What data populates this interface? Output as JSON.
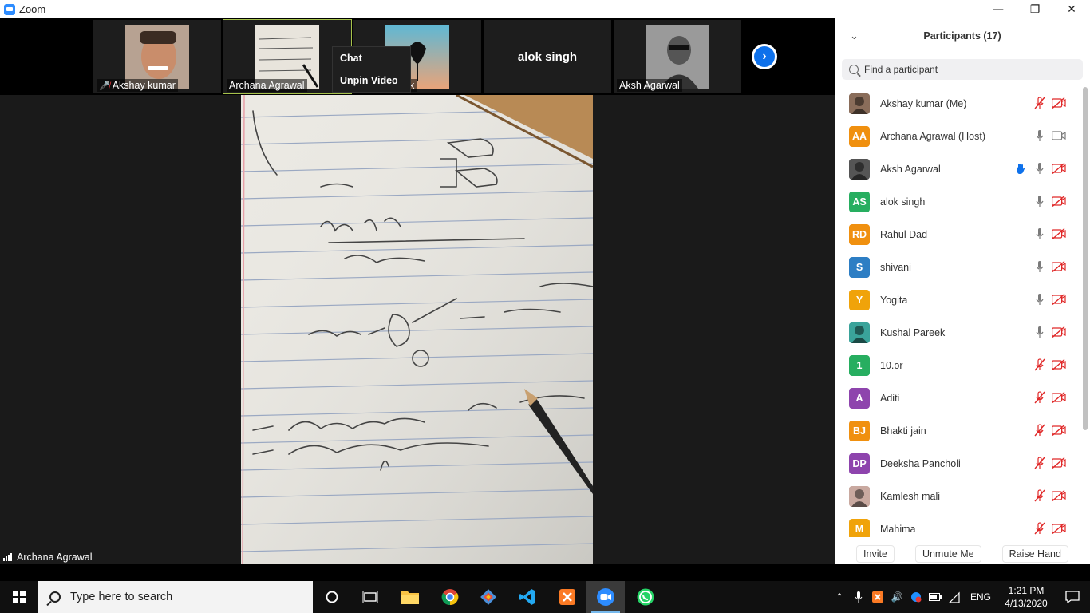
{
  "window": {
    "title": "Zoom",
    "minimize": "—",
    "maximize": "❐",
    "close": "✕"
  },
  "thumbnails": [
    {
      "label": "Akshay kumar",
      "muted": true
    },
    {
      "label": "Archana Agrawal",
      "muted": false,
      "active": true
    },
    {
      "label": "ek",
      "muted": false
    },
    {
      "bigname": "alok singh"
    },
    {
      "label": "Aksh Agarwal",
      "muted": false
    }
  ],
  "context_menu": {
    "items": [
      "Chat",
      "Unpin Video"
    ]
  },
  "main_video": {
    "speaker_label": "Archana Agrawal"
  },
  "participants_panel": {
    "title": "Participants (17)",
    "search_placeholder": "Find a participant",
    "participants": [
      {
        "name": "Akshay kumar (Me)",
        "avatar": "photo",
        "color": "#8a6d5a",
        "mic": "muted",
        "video": "off"
      },
      {
        "name": "Archana Agrawal (Host)",
        "initials": "AA",
        "color": "#f0900f",
        "mic": "on",
        "video": "on"
      },
      {
        "name": "Aksh Agarwal",
        "avatar": "photo",
        "color": "#555555",
        "mic": "on",
        "video": "off",
        "hand": true
      },
      {
        "name": "alok singh",
        "initials": "AS",
        "color": "#27ae60",
        "mic": "on",
        "video": "off"
      },
      {
        "name": "Rahul Dad",
        "initials": "RD",
        "color": "#f0900f",
        "mic": "on",
        "video": "off"
      },
      {
        "name": "shivani",
        "initials": "S",
        "color": "#2d7ec4",
        "mic": "on",
        "video": "off"
      },
      {
        "name": "Yogita",
        "initials": "Y",
        "color": "#f0a30a",
        "mic": "on",
        "video": "off"
      },
      {
        "name": "Kushal Pareek",
        "avatar": "photo",
        "color": "#3aa39a",
        "mic": "on",
        "video": "off"
      },
      {
        "name": "10.or",
        "initials": "1",
        "color": "#27ae60",
        "mic": "muted",
        "video": "off"
      },
      {
        "name": "Aditi",
        "initials": "A",
        "color": "#8e44ad",
        "mic": "muted",
        "video": "off"
      },
      {
        "name": "Bhakti jain",
        "initials": "BJ",
        "color": "#f0900f",
        "mic": "muted",
        "video": "off"
      },
      {
        "name": "Deeksha Pancholi",
        "initials": "DP",
        "color": "#8e44ad",
        "mic": "muted",
        "video": "off"
      },
      {
        "name": "Kamlesh mali",
        "avatar": "photo",
        "color": "#c9a9a0",
        "mic": "muted",
        "video": "off"
      },
      {
        "name": "Mahima",
        "initials": "M",
        "color": "#f0a30a",
        "mic": "muted",
        "video": "off"
      }
    ],
    "footer": {
      "invite": "Invite",
      "unmute": "Unmute Me",
      "raise_hand": "Raise Hand"
    }
  },
  "taskbar": {
    "search_placeholder": "Type here to search",
    "language": "ENG",
    "time": "1:21 PM",
    "date": "4/13/2020"
  }
}
